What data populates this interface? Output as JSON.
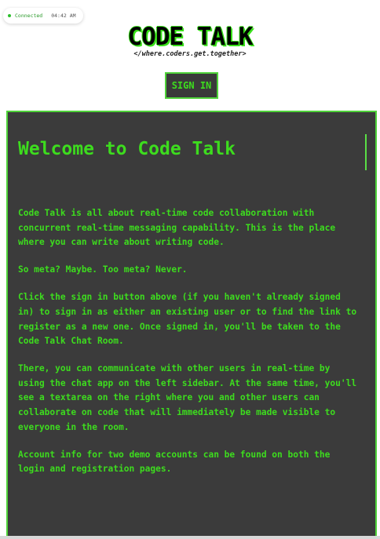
{
  "status": {
    "label": "Connected",
    "time": "04:42 AM",
    "color": "#2bbf2b"
  },
  "logo": {
    "title": "CODE TALK",
    "tagline": "</where.coders.get.together>"
  },
  "header": {
    "signin_label": "SIGN IN"
  },
  "main": {
    "title": "Welcome to Code Talk",
    "paragraphs": [
      "Code Talk is all about real-time code collaboration with concurrent real-time messaging capability. This is the place where you can write about writing code.",
      "So meta? Maybe. Too meta? Never.",
      "Click the sign in button above (if you haven't already signed in) to sign in as either an existing user or to find the link to register as a new one. Once signed in, you'll be taken to the Code Talk Chat Room.",
      "There, you can communicate with other users in real-time by using the chat app on the left sidebar. At the same time, you'll see a textarea on the right where you and other users can collaborate on code that will immediately be made visible to everyone in the room.",
      "Account info for two demo accounts can be found on both the login and registration pages."
    ]
  },
  "theme": {
    "accent": "#3ddc1e",
    "panel_bg": "#3b3b3b",
    "border": "#4fd33a"
  }
}
